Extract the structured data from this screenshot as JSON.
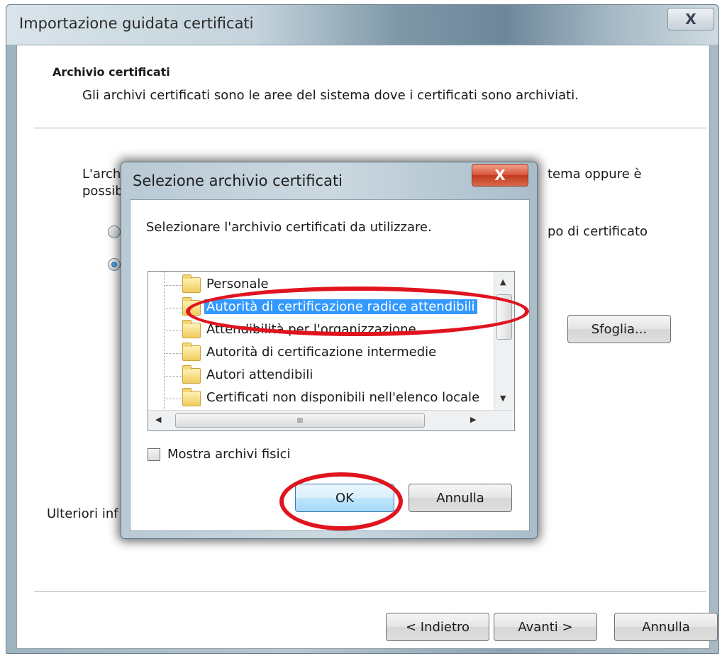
{
  "wizard": {
    "title": "Importazione guidata certificati",
    "close_glyph": "X",
    "heading": "Archivio certificati",
    "description": "Gli archivi certificati sono le aree del sistema dove i certificati sono archiviati.",
    "intro_left_line1": "L'arch",
    "intro_left_line2": "possib",
    "intro_right": "tema oppure è",
    "cert_type_right": "po di certificato",
    "browse_label": "Sfoglia...",
    "more_info": "Ulteriori inf",
    "back_label": "< Indietro",
    "next_label": "Avanti >",
    "cancel_label": "Annulla"
  },
  "dialog": {
    "title": "Selezione archivio certificati",
    "close_glyph": "X",
    "instruction": "Selezionare l'archivio certificati da utilizzare.",
    "tree_items": [
      {
        "label": "Personale",
        "selected": false
      },
      {
        "label": "Autorità di certificazione radice attendibili",
        "selected": true
      },
      {
        "label": "Attendibilità per l'organizzazione",
        "selected": false
      },
      {
        "label": "Autorità di certificazione intermedie",
        "selected": false
      },
      {
        "label": "Autori attendibili",
        "selected": false
      },
      {
        "label": "Certificati non disponibili nell'elenco locale",
        "selected": false
      }
    ],
    "scroll_up_glyph": "▲",
    "scroll_down_glyph": "▼",
    "scroll_left_glyph": "◀",
    "scroll_right_glyph": "▶",
    "scroll_grip": "III",
    "show_physical_label": "Mostra archivi fisici",
    "show_physical_checked": false,
    "ok_label": "OK",
    "cancel_label": "Annulla"
  },
  "colors": {
    "selection": "#3399ff",
    "annotation": "#e0141e"
  }
}
